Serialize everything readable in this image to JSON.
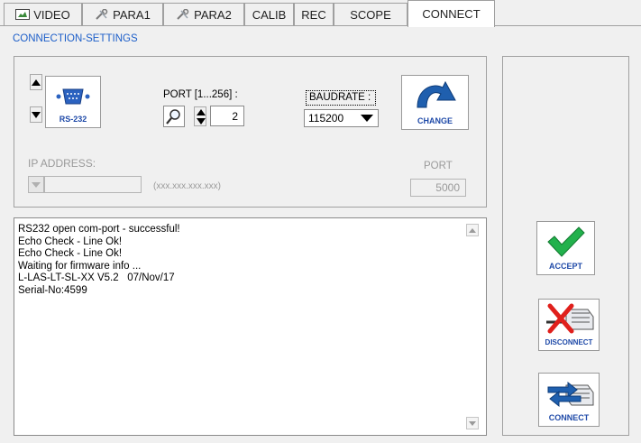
{
  "tabs": [
    {
      "label": "VIDEO",
      "icon": "video-icon"
    },
    {
      "label": "PARA1",
      "icon": "tools-icon"
    },
    {
      "label": "PARA2",
      "icon": "tools-icon"
    },
    {
      "label": "CALIB",
      "icon": ""
    },
    {
      "label": "REC",
      "icon": ""
    },
    {
      "label": "SCOPE",
      "icon": ""
    },
    {
      "label": "CONNECT",
      "icon": "",
      "active": true
    }
  ],
  "section_title": "CONNECTION-SETTINGS",
  "interface": {
    "button_label": "RS-232",
    "icon": "serial-port-icon"
  },
  "port": {
    "label": "PORT [1...256] :",
    "value": "2",
    "search_icon": "magnifier-icon"
  },
  "baudrate": {
    "label": "BAUDRATE :",
    "value": "115200"
  },
  "change_button": {
    "label": "CHANGE",
    "icon": "curved-arrow-icon"
  },
  "ip": {
    "label": "IP ADDRESS:",
    "placeholder": "(xxx.xxx.xxx.xxx)",
    "value": ""
  },
  "tcp_port": {
    "label": "PORT",
    "value": "5000"
  },
  "log_lines": [
    "RS232 open com-port - successful!",
    "Echo Check - Line Ok!",
    "Echo Check - Line Ok!",
    "Waiting for firmware info ...",
    "L-LAS-LT-SL-XX V5.2   07/Nov/17",
    "Serial-No:4599"
  ],
  "actions": {
    "accept": "ACCEPT",
    "disconnect": "DISCONNECT",
    "connect": "CONNECT"
  },
  "colors": {
    "accent_text": "#1c5ec9",
    "accept_check": "#22b14c",
    "disconnect_x": "#e0201c",
    "change_arrow": "#1f5fae",
    "connect_arrows": "#1f5fae"
  }
}
